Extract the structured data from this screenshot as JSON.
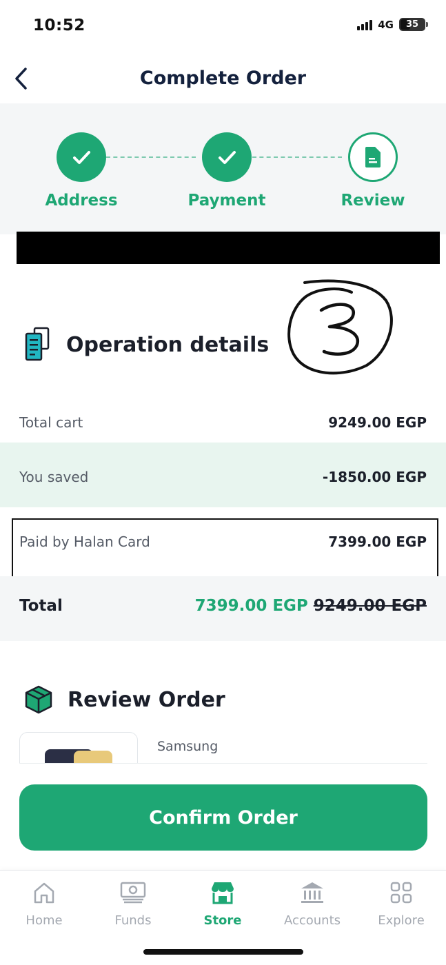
{
  "status_bar": {
    "time": "10:52",
    "network": "4G",
    "battery": "35"
  },
  "header": {
    "title": "Complete Order",
    "back_icon": "chevron-left-icon"
  },
  "stepper": {
    "steps": [
      {
        "label": "Address",
        "state": "done",
        "icon": "check-icon"
      },
      {
        "label": "Payment",
        "state": "done",
        "icon": "check-icon"
      },
      {
        "label": "Review",
        "state": "current",
        "icon": "document-icon"
      }
    ]
  },
  "operation_details": {
    "title": "Operation details",
    "icon": "receipt-icon",
    "rows": [
      {
        "label": "Total cart",
        "value": "9249.00 EGP"
      },
      {
        "label": "You saved",
        "value": "-1850.00 EGP"
      },
      {
        "label": "Paid by Halan Card",
        "value": "7399.00 EGP"
      }
    ],
    "total": {
      "label": "Total",
      "value": "7399.00 EGP",
      "old_value": "9249.00 EGP"
    }
  },
  "review_order": {
    "title": "Review Order",
    "icon": "box-icon",
    "items": [
      {
        "brand": "Samsung"
      }
    ]
  },
  "confirm_button": {
    "label": "Confirm Order"
  },
  "bottom_nav": {
    "items": [
      {
        "label": "Home",
        "icon": "home-icon",
        "active": false
      },
      {
        "label": "Funds",
        "icon": "cash-icon",
        "active": false
      },
      {
        "label": "Store",
        "icon": "store-icon",
        "active": true
      },
      {
        "label": "Accounts",
        "icon": "bank-icon",
        "active": false
      },
      {
        "label": "Explore",
        "icon": "grid-icon",
        "active": false
      }
    ]
  },
  "colors": {
    "accent": "#1ea774",
    "title": "#14213d",
    "saved_bg": "#e8f5ef",
    "muted": "#a4a9b1"
  }
}
